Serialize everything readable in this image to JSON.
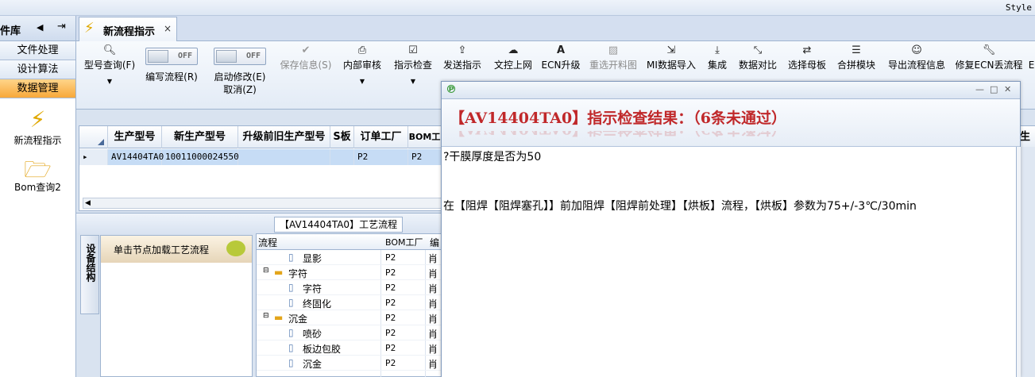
{
  "topbar": {
    "style_label": "Style"
  },
  "leftnav": {
    "title": "件库",
    "arrow_icon": "triangle-left-icon",
    "pin_icon": "pin-icon",
    "buttons": [
      "文件处理",
      "设计算法",
      "数据管理"
    ],
    "active_index": 2,
    "shortcuts": [
      {
        "label": "新流程指示",
        "icon": "lightning-icon"
      },
      {
        "label": "Bom查询2",
        "icon": "folder-open-icon"
      }
    ]
  },
  "tab": {
    "label": "新流程指示",
    "close": "×"
  },
  "toolbar": {
    "items": [
      {
        "label": "型号查询(F)",
        "icon": "search-icon"
      },
      {
        "label": "编写流程(R)",
        "toggle": "OFF"
      },
      {
        "label": "启动修改(E)",
        "toggle": "OFF",
        "sub": "取消(Z)"
      },
      {
        "label": "保存信息(S)",
        "icon": "check-icon",
        "disabled": true
      },
      {
        "label": "内部审核",
        "icon": "printer-icon"
      },
      {
        "label": "指示检查",
        "icon": "checkbox-icon"
      },
      {
        "label": "发送指示",
        "icon": "upload-icon"
      },
      {
        "label": "文控上网",
        "icon": "cloud-upload-icon"
      },
      {
        "label": "ECN升级",
        "icon": "font-a-icon"
      },
      {
        "label": "重选开料图",
        "icon": "image-icon",
        "disabled": true
      },
      {
        "label": "MI数据导入",
        "icon": "sign-in-icon"
      },
      {
        "label": "集成",
        "icon": "download-icon"
      },
      {
        "label": "数据对比",
        "icon": "compress-icon"
      },
      {
        "label": "选择母板",
        "icon": "shuffle-icon"
      },
      {
        "label": "合拼模块",
        "icon": "list-icon"
      },
      {
        "label": "导出流程信息",
        "icon": "smiley-icon"
      },
      {
        "label": "修复ECN丢流程",
        "icon": "wrench-icon"
      },
      {
        "label": "E",
        "icon": "more-icon"
      }
    ],
    "dropdown_glyph": "▼"
  },
  "grid": {
    "columns": [
      "生产型号",
      "新生产型号",
      "升级前旧生产型号",
      "S板",
      "订单工厂",
      "BOM工"
    ],
    "right_col_fragment": "生产",
    "row": [
      "AV14404TA0",
      "10011000024550",
      "",
      "",
      "P2",
      "P2"
    ],
    "row_marker": "▸",
    "scroll_left": "◀"
  },
  "process": {
    "title": "【AV14404TA0】工艺流程",
    "side_tab": "设备结构",
    "node_hint": "单击节点加载工艺流程",
    "tree_headers": [
      "流程",
      "BOM工厂",
      "编"
    ],
    "tree_rows": [
      {
        "name": "显影",
        "type": "doc",
        "level": 2,
        "bom": "P2",
        "ed": "肖"
      },
      {
        "name": "字符",
        "type": "folder",
        "level": 1,
        "bom": "P2",
        "ed": "肖"
      },
      {
        "name": "字符",
        "type": "doc",
        "level": 2,
        "bom": "P2",
        "ed": "肖"
      },
      {
        "name": "终固化",
        "type": "doc",
        "level": 2,
        "bom": "P2",
        "ed": "肖"
      },
      {
        "name": "沉金",
        "type": "folder",
        "level": 1,
        "bom": "P2",
        "ed": "肖"
      },
      {
        "name": "喷砂",
        "type": "doc",
        "level": 2,
        "bom": "P2",
        "ed": "肖"
      },
      {
        "name": "板边包胶",
        "type": "doc",
        "level": 2,
        "bom": "P2",
        "ed": "肖"
      },
      {
        "name": "沉金",
        "type": "doc",
        "level": 2,
        "bom": "P2",
        "ed": "肖"
      }
    ]
  },
  "popup": {
    "app_icon": "p-logo-icon",
    "controls": [
      "—",
      "□",
      "✕"
    ],
    "header": "【AV14404TA0】指示检查结果：（6条未通过）",
    "lines": [
      "?干膜厚度是否为50",
      "在【阻焊【阻焊塞孔】】前加阻焊【阻焊前处理】【烘板】流程，【烘板】参数为75+/-3℃/30min"
    ]
  }
}
